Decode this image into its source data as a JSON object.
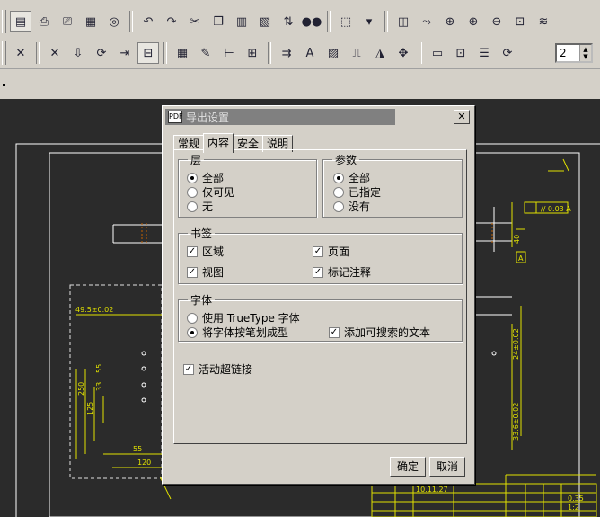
{
  "toolbar1": {
    "icons": [
      "pdf-export-icon",
      "print-icon",
      "print-preview-icon",
      "pdf-icon",
      "open-icon",
      "undo-icon",
      "redo-icon",
      "cut-icon",
      "copy-icon",
      "paste-icon",
      "paste-special-icon",
      "property-icon",
      "binoculars-icon",
      "select-box-icon",
      "dropdown-icon",
      "view-icon",
      "graph-icon",
      "zoom-window-icon",
      "zoom-in-icon",
      "zoom-out-icon",
      "zoom-fit-icon",
      "layers-icon"
    ]
  },
  "toolbar2": {
    "icons": [
      "snap-icon",
      "delete-icon",
      "insert-icon",
      "refresh-icon",
      "import-icon",
      "lock-icon",
      "grid-icon",
      "edit-icon",
      "dimension-icon",
      "table-icon",
      "align-icon",
      "text-icon",
      "hatch-icon",
      "measure-icon",
      "select-icon",
      "move-icon",
      "folder-icon",
      "block-icon",
      "list-icon",
      "refresh2-icon"
    ],
    "stepper_value": "2"
  },
  "dialog": {
    "title_icon": "PDF",
    "title": "导出设置",
    "close_glyph": "✕",
    "tabs": [
      "常规",
      "内容",
      "安全",
      "说明"
    ],
    "active_tab": 1,
    "layers": {
      "legend": "层",
      "options": [
        "全部",
        "仅可见",
        "无"
      ],
      "selected": 0
    },
    "params": {
      "legend": "参数",
      "options": [
        "全部",
        "已指定",
        "没有"
      ],
      "selected": 0
    },
    "bookmarks": {
      "legend": "书签",
      "items": [
        {
          "label": "区域",
          "checked": true
        },
        {
          "label": "页面",
          "checked": true
        },
        {
          "label": "视图",
          "checked": true
        },
        {
          "label": "标记注释",
          "checked": true
        }
      ]
    },
    "fonts": {
      "legend": "字体",
      "use_truetype": "使用 TrueType 字体",
      "stroke_fonts": "将字体按笔划成型",
      "selected": 1,
      "searchable_text": "添加可搜索的文本",
      "searchable_checked": true
    },
    "hyperlinks": {
      "label": "活动超链接",
      "checked": true
    },
    "ok": "确定",
    "cancel": "取消"
  },
  "drawing": {
    "dim_left": "49.5±0.02",
    "dim_250": "250",
    "dim_55": "55",
    "dim_33": "33",
    "dim_125": "125",
    "dim_120": "120",
    "dim_55b": "55",
    "dim_right1": "24±0.02",
    "dim_right2": "33.6±0.02",
    "dim_40": "40",
    "tol_frame": "// 0.03 A",
    "datum": "A",
    "title_block_date": "10.11.27",
    "title_block_ratio": "0.35",
    "title_block_scale": "1:2"
  }
}
